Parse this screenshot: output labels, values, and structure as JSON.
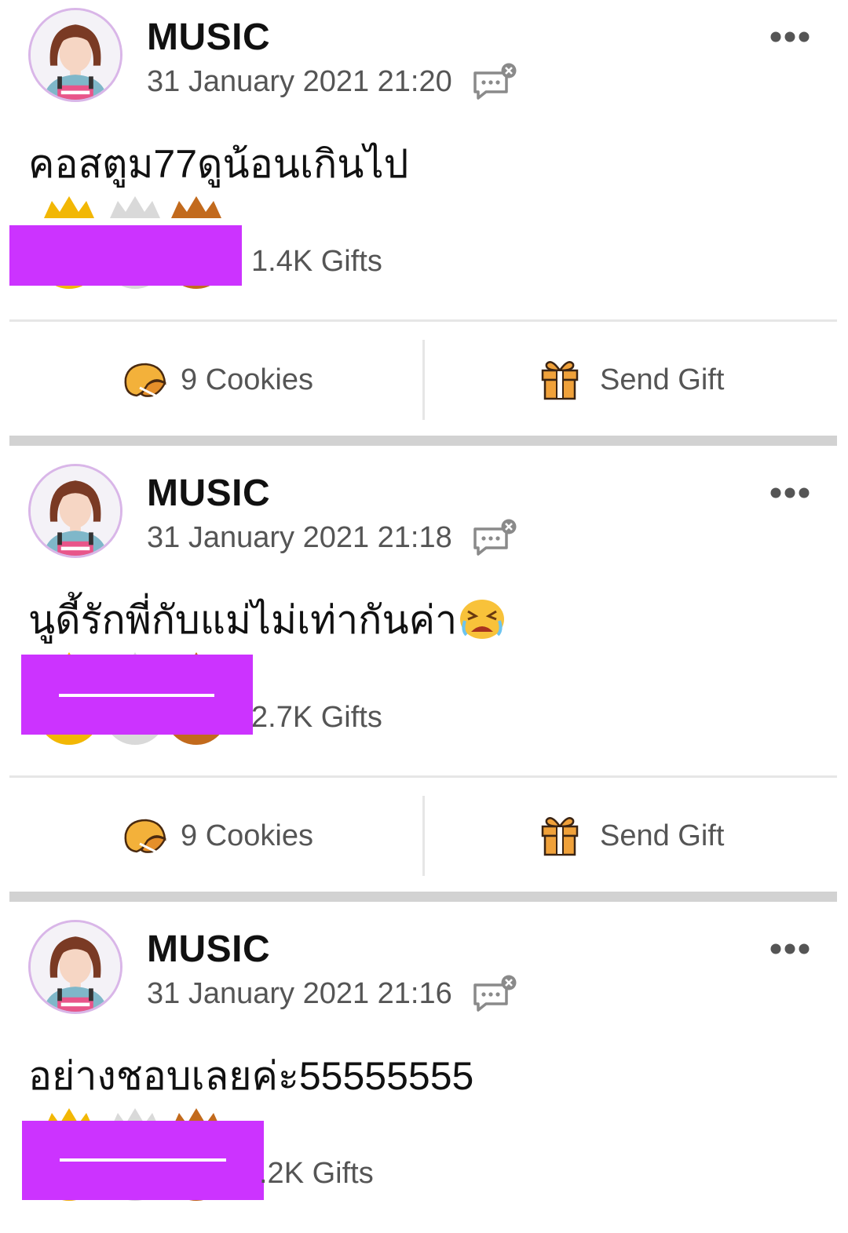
{
  "feed": {
    "posts": [
      {
        "author": "MUSIC",
        "timestamp": "31 January 2021 21:20",
        "text": "คอสตูม77ดูน้อนเกินไป",
        "has_emoji": false,
        "gifts": "1.4K Gifts",
        "cookies": "9 Cookies",
        "send_gift": "Send Gift"
      },
      {
        "author": "MUSIC",
        "timestamp": "31 January 2021 21:18",
        "text": "นูดี้รักพี่กับแม่ไม่เท่ากันค่า",
        "has_emoji": true,
        "gifts": "2.7K Gifts",
        "cookies": "9 Cookies",
        "send_gift": "Send Gift"
      },
      {
        "author": "MUSIC",
        "timestamp": "31 January 2021 21:16",
        "text": "อย่างชอบเลยค่ะ55555555",
        "has_emoji": false,
        "gifts": ".2K Gifts"
      }
    ]
  },
  "icons": {
    "avatar": "member-avatar",
    "comments_disabled": "comment-disabled-icon",
    "more": "more-options-icon",
    "crown_gold": "gold-crown-icon",
    "crown_silver": "silver-crown-icon",
    "crown_bronze": "bronze-crown-icon",
    "cookie": "fortune-cookie-icon",
    "gift": "gift-box-icon",
    "emoji": "crying-face-emoji"
  },
  "colors": {
    "redaction": "#cc33ff",
    "divider": "#e6e6e6",
    "section_gap": "#d2d2d2",
    "avatar_ring": "#d9b6e8",
    "gold": "#f2b705",
    "bronze": "#c26a1d"
  }
}
